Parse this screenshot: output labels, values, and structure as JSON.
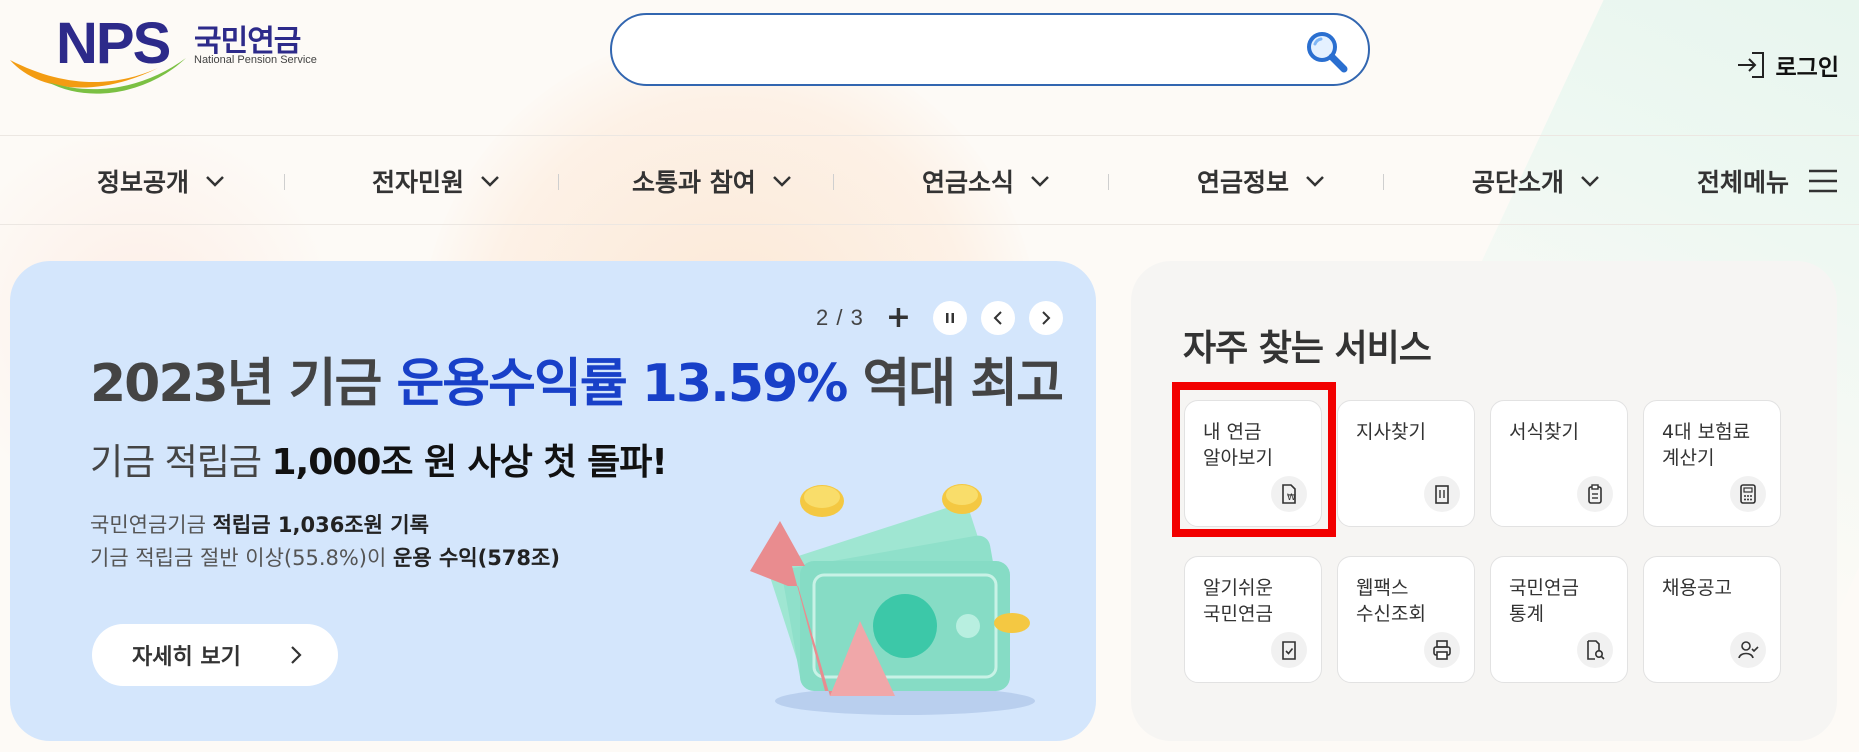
{
  "header": {
    "logo": {
      "brand": "NPS",
      "korean": "국민연금",
      "english": "National Pension Service"
    },
    "search": {
      "value": "",
      "placeholder": ""
    },
    "login_label": "로그인"
  },
  "nav": {
    "items": [
      {
        "label": "정보공개"
      },
      {
        "label": "전자민원"
      },
      {
        "label": "소통과 참여"
      },
      {
        "label": "연금소식"
      },
      {
        "label": "연금정보"
      },
      {
        "label": "공단소개"
      }
    ],
    "all_menu_label": "전체메뉴"
  },
  "banner": {
    "counter": "2 / 3",
    "headline_prefix": "2023년 기금 ",
    "headline_highlight": "운용수익률 13.59%",
    "headline_suffix": " 역대 최고",
    "subhead_prefix": "기금 적립금 ",
    "subhead_bold": "1,000조 원 사상 첫 돌파!",
    "line1_prefix": "국민연금기금 ",
    "line1_bold": "적립금 1,036조원 기록",
    "line2_prefix": "기금 적립금 절반 이상(55.8%)이 ",
    "line2_bold": "운용 수익(578조)",
    "more_label": "자세히 보기"
  },
  "services": {
    "title": "자주 찾는 서비스",
    "items": [
      {
        "label": "내 연금\n알아보기",
        "icon": "pension-doc-icon"
      },
      {
        "label": "지사찾기",
        "icon": "building-icon"
      },
      {
        "label": "서식찾기",
        "icon": "clipboard-icon"
      },
      {
        "label": "4대 보험료\n계산기",
        "icon": "calculator-icon"
      },
      {
        "label": "알기쉬운\n국민연금",
        "icon": "doc-check-icon"
      },
      {
        "label": "웹팩스\n수신조회",
        "icon": "printer-icon"
      },
      {
        "label": "국민연금\n통계",
        "icon": "doc-search-icon"
      },
      {
        "label": "채용공고",
        "icon": "user-check-icon"
      }
    ]
  },
  "colors": {
    "brand_navy": "#2d2a8a",
    "accent_blue": "#1840c8",
    "banner_bg": "#d4e6fc",
    "highlight_red": "#f20000"
  }
}
